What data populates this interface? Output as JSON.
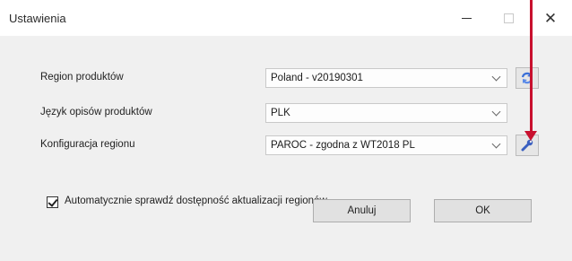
{
  "window": {
    "title": "Ustawienia",
    "minimize_icon": "minimize-icon",
    "maximize_icon": "maximize-icon",
    "close_icon": "close-icon",
    "close_glyph": "✕"
  },
  "settings": {
    "region": {
      "label": "Region produktów",
      "value": "Poland - v20190301",
      "button_icon": "refresh-icon"
    },
    "language": {
      "label": "Język opisów produktów",
      "value": "PLK"
    },
    "config": {
      "label": "Konfiguracja regionu",
      "value": "PAROC - zgodna z WT2018 PL",
      "button_icon": "wrench-icon"
    },
    "auto_check": {
      "label": "Automatycznie sprawdź dostępność aktualizacji regionów",
      "checked": true
    }
  },
  "buttons": {
    "cancel": "Anuluj",
    "ok": "OK"
  },
  "colors": {
    "annotation_arrow": "#c8102e",
    "icon_blue": "#3a6fd8"
  }
}
